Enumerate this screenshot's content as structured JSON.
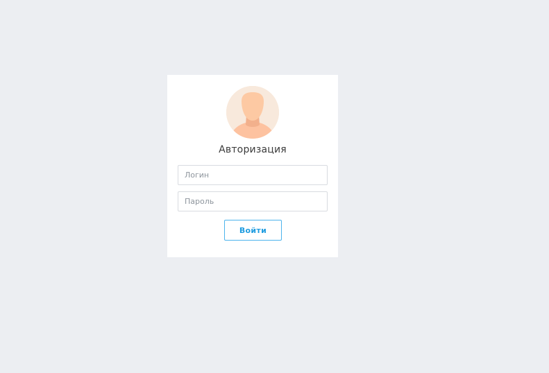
{
  "login_form": {
    "avatar_icon": "user-avatar-icon",
    "title": "Авторизация",
    "login_placeholder": "Логин",
    "login_value": "",
    "password_placeholder": "Пароль",
    "password_value": "",
    "submit_label": "Войти"
  },
  "colors": {
    "page_background": "#eceef2",
    "card_background": "#ffffff",
    "accent": "#1e9ce0",
    "avatar_background": "#f8e9dc",
    "avatar_skin": "#fdc9a3"
  }
}
